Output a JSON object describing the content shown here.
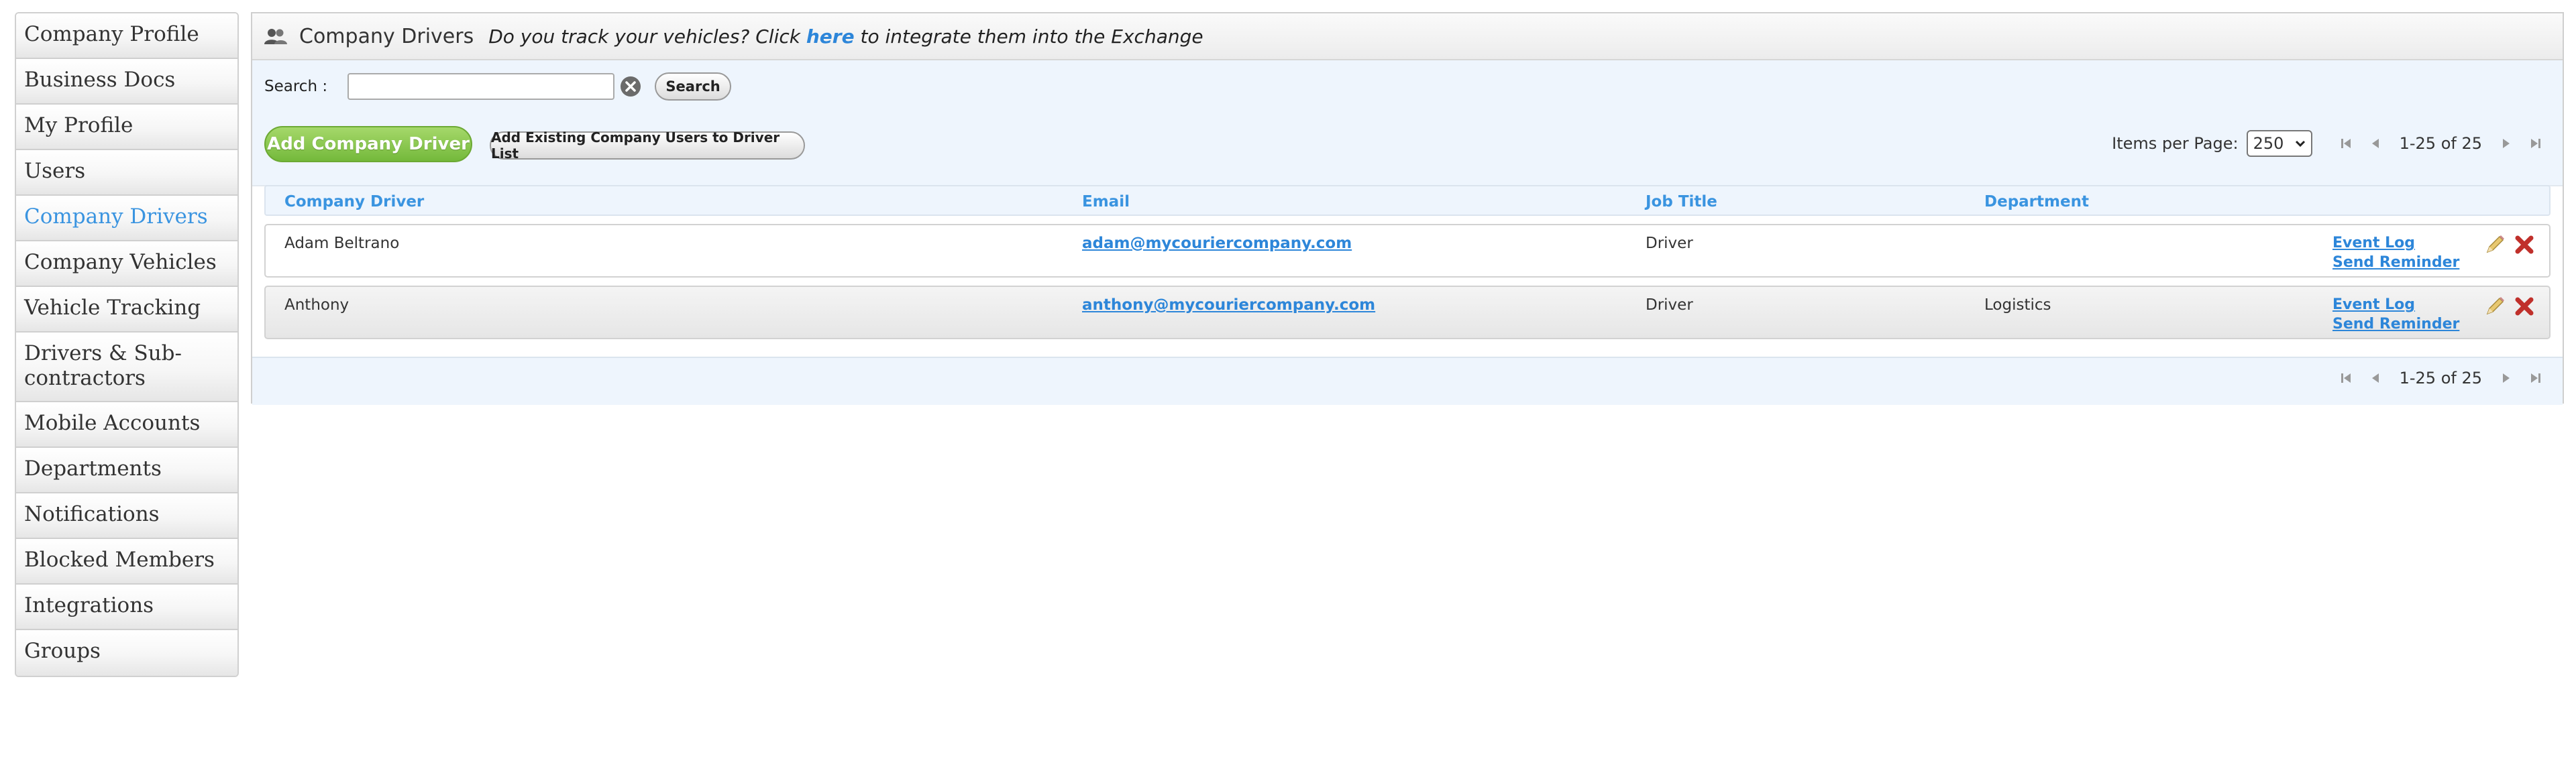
{
  "sidebar": {
    "items": [
      {
        "label": "Company Profile",
        "active": false
      },
      {
        "label": "Business Docs",
        "active": false
      },
      {
        "label": "My Profile",
        "active": false
      },
      {
        "label": "Users",
        "active": false
      },
      {
        "label": "Company Drivers",
        "active": true
      },
      {
        "label": "Company Vehicles",
        "active": false
      },
      {
        "label": "Vehicle Tracking",
        "active": false
      },
      {
        "label": "Drivers & Sub-contractors",
        "active": false
      },
      {
        "label": "Mobile Accounts",
        "active": false
      },
      {
        "label": "Departments",
        "active": false
      },
      {
        "label": "Notifications",
        "active": false
      },
      {
        "label": "Blocked Members",
        "active": false
      },
      {
        "label": "Integrations",
        "active": false
      },
      {
        "label": "Groups",
        "active": false
      }
    ]
  },
  "header": {
    "title": "Company Drivers",
    "promo_prefix": "Do you track your vehicles? Click ",
    "promo_link": "here",
    "promo_suffix": " to integrate them into the Exchange"
  },
  "search": {
    "label": "Search :",
    "value": "",
    "placeholder": "",
    "button_label": "Search"
  },
  "buttons": {
    "add_driver": "Add Company Driver",
    "add_existing": "Add Existing Company Users to Driver List"
  },
  "pagination": {
    "items_per_page_label": "Items per Page:",
    "items_per_page_value": "250",
    "range_text": "1-25 of 25"
  },
  "table": {
    "columns": [
      "Company Driver",
      "Email",
      "Job Title",
      "Department"
    ],
    "rows": [
      {
        "name": "Adam Beltrano",
        "email": "adam@mycouriercompany.com",
        "job_title": "Driver",
        "department": "",
        "event_log": "Event Log",
        "send_reminder": "Send Reminder"
      },
      {
        "name": "Anthony",
        "email": "anthony@mycouriercompany.com",
        "job_title": "Driver",
        "department": "Logistics",
        "event_log": "Event Log",
        "send_reminder": "Send Reminder"
      }
    ]
  },
  "icons": {
    "header": "people-icon",
    "clear": "clear-search-icon",
    "edit": "pencil-icon",
    "delete": "delete-x-icon",
    "pager": [
      "first-page-icon",
      "prev-page-icon",
      "next-page-icon",
      "last-page-icon"
    ]
  },
  "colors": {
    "link_blue": "#2d86d9",
    "active_nav": "#3a94e0",
    "green_button": "#7dc043",
    "delete_red": "#c0302b",
    "toolbar_bg": "#eef5fd"
  }
}
